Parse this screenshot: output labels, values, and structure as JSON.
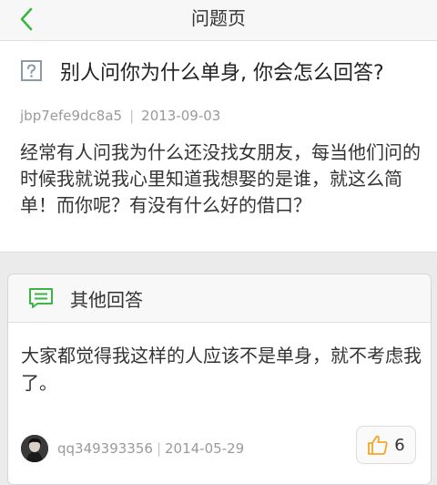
{
  "nav": {
    "title": "问题页"
  },
  "question": {
    "title": "别人问你为什么单身, 你会怎么回答?",
    "author": "jbp7efe9dc8a5",
    "separator": "|",
    "date": "2013-09-03",
    "body": "经常有人问我为什么还没找女朋友，每当他们问的时候我就说我心里知道我想娶的是谁，就这么简单！而你呢？有没有什么好的借口？"
  },
  "answers": {
    "heading": "其他回答",
    "items": [
      {
        "body": "大家都觉得我这样的人应该不是单身，就不考虑我了。",
        "author": "qq349393356",
        "separator": "|",
        "date": "2014-05-29",
        "likes": "6"
      }
    ]
  },
  "colors": {
    "accent_green": "#3cb545",
    "icon_gray": "#8a9aa6",
    "like_orange": "#f5a623"
  }
}
